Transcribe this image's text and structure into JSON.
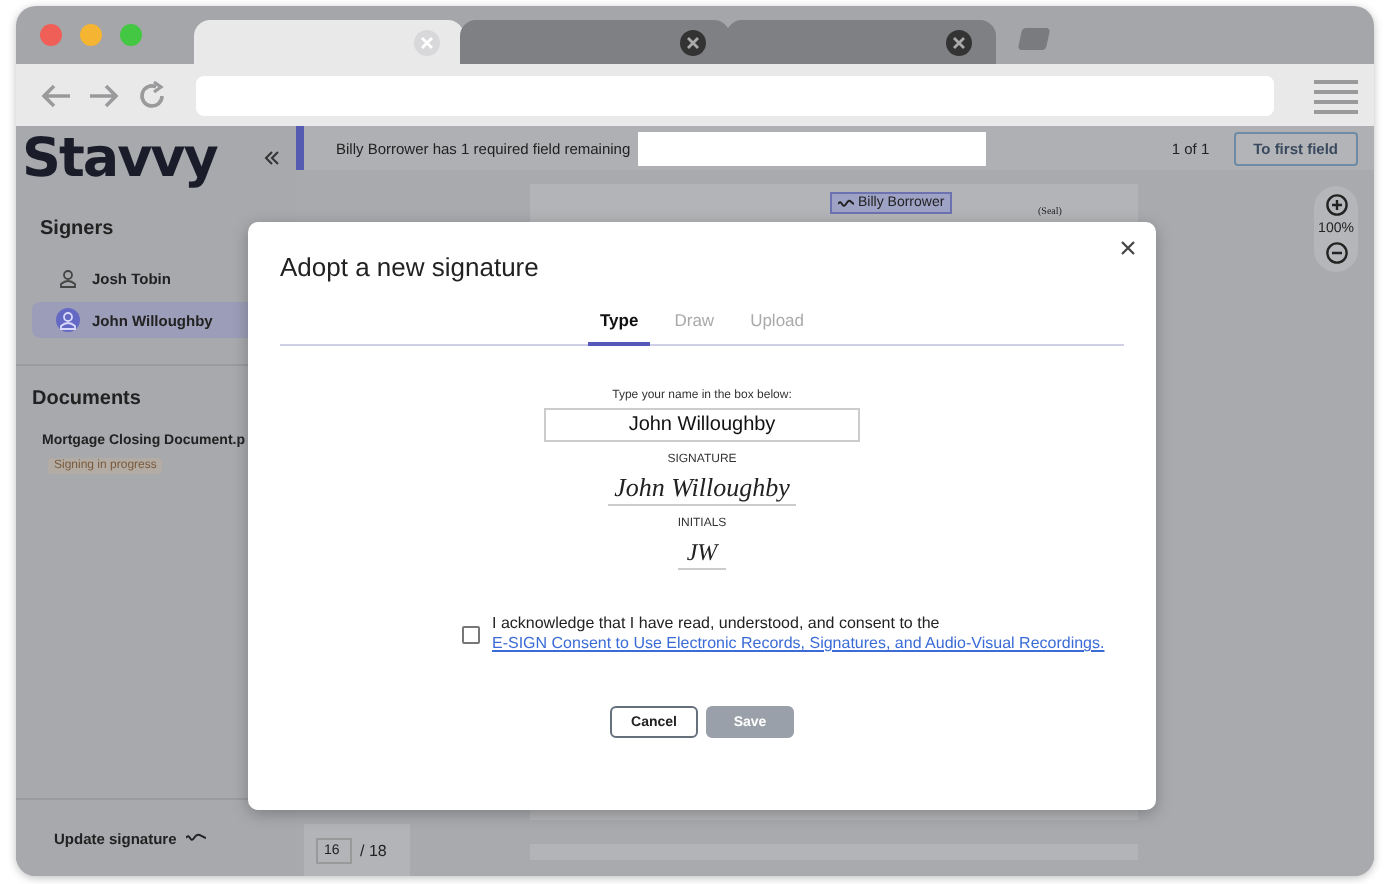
{
  "browser": {
    "tabs": [
      {
        "selected": true
      },
      {
        "selected": false
      },
      {
        "selected": false
      }
    ]
  },
  "sidebar": {
    "logo": "Stavvy",
    "signers_title": "Signers",
    "signers": [
      {
        "name": "Josh Tobin",
        "selected": false
      },
      {
        "name": "John Willoughby",
        "selected": true
      }
    ],
    "documents_title": "Documents",
    "documents": [
      {
        "name": "Mortgage Closing Document.p",
        "status": "Signing in progress"
      }
    ],
    "update_signature": "Update signature"
  },
  "banner": {
    "message": "Billy Borrower has 1 required field remaining",
    "counter": "1 of 1",
    "button": "To first field"
  },
  "document": {
    "field_tag": "Billy Borrower",
    "seal": "(Seal)",
    "zoom": "100%",
    "page": "16",
    "page_total": "/ 18"
  },
  "modal": {
    "title": "Adopt a new signature",
    "tabs": [
      {
        "label": "Type",
        "selected": true
      },
      {
        "label": "Draw",
        "selected": false
      },
      {
        "label": "Upload",
        "selected": false
      }
    ],
    "prompt": "Type your name in the box below:",
    "name_value": "John Willoughby",
    "signature_label": "SIGNATURE",
    "signature": "John Willoughby",
    "initials_label": "INITIALS",
    "initials": "JW",
    "consent": {
      "checked": false,
      "text": "I acknowledge that I have read, understood, and consent to the",
      "link": "E-SIGN Consent to Use Electronic Records, Signatures, and Audio-Visual Recordings."
    },
    "buttons": [
      {
        "label": "Cancel",
        "disabled": false
      },
      {
        "label": "Save",
        "disabled": true
      }
    ]
  }
}
